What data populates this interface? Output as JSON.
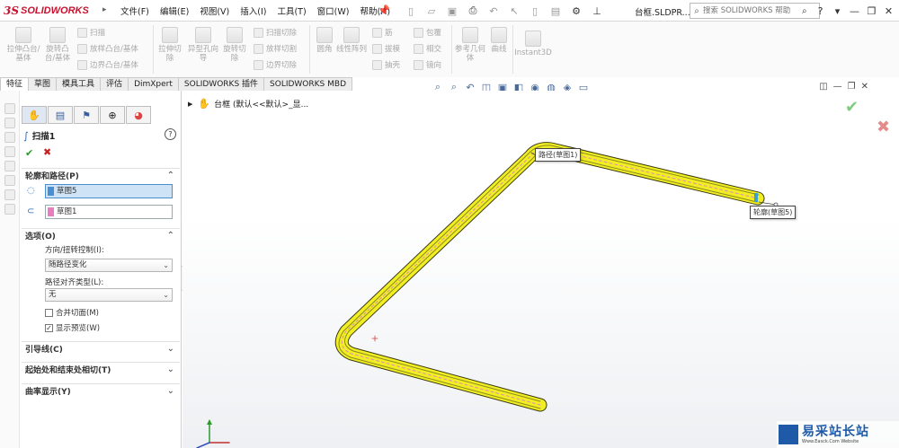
{
  "app": {
    "logo_prefix": "3S",
    "logo_word": "SOLIDWORKS",
    "doc_title": "台框.SLDPR..."
  },
  "menu": [
    "文件(F)",
    "编辑(E)",
    "视图(V)",
    "插入(I)",
    "工具(T)",
    "窗口(W)",
    "帮助(H)"
  ],
  "search": {
    "placeholder": "搜索 SOLIDWORKS 帮助"
  },
  "cmdmgr": {
    "boss_extrude": "拉伸凸台/基体",
    "boss_revolve": "旋转凸台/基体",
    "sweep": "扫描",
    "loft": "放样凸台/基体",
    "boundary": "边界凸台/基体",
    "cut_extrude": "拉伸切除",
    "hole_wizard": "异型孔向导",
    "cut_revolve": "旋转切除",
    "swept_cut": "扫描切除",
    "lofted_cut": "放样切割",
    "boundary_cut": "边界切除",
    "fillet": "圆角",
    "linear_pattern": "线性阵列",
    "rib": "筋",
    "draft": "拔模",
    "shell": "抽壳",
    "wrap": "包覆",
    "intersect": "相交",
    "mirror": "镜向",
    "ref_geometry": "参考几何体",
    "curves": "曲线",
    "instant3d": "Instant3D"
  },
  "tabs": [
    "特征",
    "草图",
    "模具工具",
    "评估",
    "DimXpert",
    "SOLIDWORKS 插件",
    "SOLIDWORKS MBD"
  ],
  "pm": {
    "title": "扫描1",
    "profile_group": "轮廓和路径(P)",
    "profile_value": "草图5",
    "path_value": "草图1",
    "options_group": "选项(O)",
    "orient_label": "方向/扭转控制(I):",
    "orient_value": "随路径变化",
    "align_label": "路径对齐类型(L):",
    "align_value": "无",
    "merge_faces": "合并切面(M)",
    "show_preview": "显示预览(W)",
    "guide_group": "引导线(C)",
    "tangency_group": "起始处和结束处相切(T)",
    "curvature_group": "曲率显示(Y)"
  },
  "viewport": {
    "tree_label": "台框 (默认<<默认>_显...",
    "path_callout": "路径(草图1)",
    "profile_callout": "轮廓(草图5)"
  },
  "watermark": {
    "cn": "易采站长站",
    "en": "Www.Easck.Com Website"
  }
}
